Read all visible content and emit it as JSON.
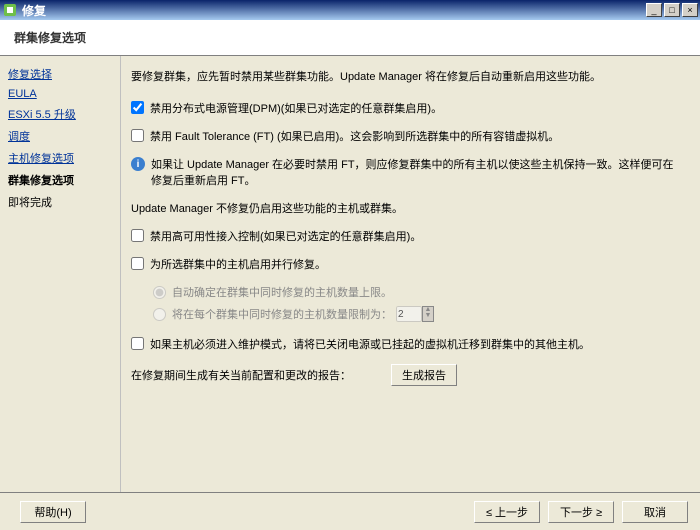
{
  "window": {
    "title": "修复"
  },
  "header": {
    "title": "群集修复选项"
  },
  "sidebar": {
    "items": [
      {
        "label": "修复选择",
        "link": true
      },
      {
        "label": "EULA",
        "link": true
      },
      {
        "label": "ESXi 5.5 升级",
        "link": true
      },
      {
        "label": "调度",
        "link": true
      },
      {
        "label": "主机修复选项",
        "link": true
      },
      {
        "label": "群集修复选项",
        "link": false,
        "current": true
      },
      {
        "label": "即将完成",
        "link": false
      }
    ]
  },
  "content": {
    "intro": "要修复群集，应先暂时禁用某些群集功能。Update Manager 将在修复后自动重新启用这些功能。",
    "opt_dpm": {
      "label": "禁用分布式电源管理(DPM)(如果已对选定的任意群集启用)。"
    },
    "opt_ft": {
      "label": "禁用 Fault Tolerance (FT) (如果已启用)。这会影响到所选群集中的所有容错虚拟机。"
    },
    "info_note": "如果让 Update Manager 在必要时禁用 FT，则应修复群集中的所有主机以使这些主机保持一致。这样便可在修复后重新启用 FT。",
    "constraint_note": "Update Manager 不修复仍启用这些功能的主机或群集。",
    "opt_ha": {
      "label": "禁用高可用性接入控制(如果已对选定的任意群集启用)。"
    },
    "opt_parallel": {
      "label": "为所选群集中的主机启用并行修复。"
    },
    "radio_auto": {
      "label": "自动确定在群集中同时修复的主机数量上限。"
    },
    "radio_limit": {
      "label": "将在每个群集中同时修复的主机数量限制为：",
      "value": "2"
    },
    "opt_migrate": {
      "label": "如果主机必须进入维护模式，请将已关闭电源或已挂起的虚拟机迁移到群集中的其他主机。"
    },
    "report_label": "在修复期间生成有关当前配置和更改的报告：",
    "report_button": "生成报告"
  },
  "footer": {
    "help": "帮助(H)",
    "back": "≤ 上一步",
    "next": "下一步 ≥",
    "cancel": "取消"
  }
}
